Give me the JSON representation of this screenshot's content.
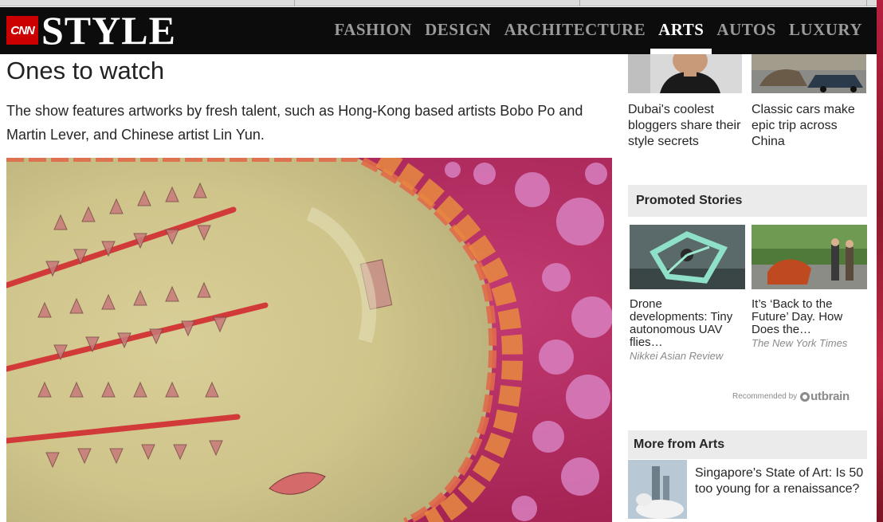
{
  "header": {
    "brand_cnn": "CNN",
    "brand_style": "STYLE",
    "nav": [
      {
        "label": "FASHION",
        "active": false
      },
      {
        "label": "DESIGN",
        "active": false
      },
      {
        "label": "ARCHITECTURE",
        "active": false
      },
      {
        "label": "ARTS",
        "active": true
      },
      {
        "label": "AUTOS",
        "active": false
      },
      {
        "label": "LUXURY",
        "active": false
      }
    ]
  },
  "article": {
    "title": "Ones to watch",
    "body": "The show features artworks by fresh talent, such as Hong-Kong based artists Bobo Po and Martin Lever, and Chinese artist Lin Yun."
  },
  "sidebar": {
    "related": [
      {
        "title": "Dubai's coolest bloggers share their style secrets"
      },
      {
        "title": "Classic cars make epic trip across China"
      }
    ],
    "promoted": {
      "heading": "Promoted Stories",
      "items": [
        {
          "title": "Drone developments: Tiny autonomous UAV flies…",
          "source": "Nikkei Asian Review"
        },
        {
          "title": "It’s ‘Back to the Future’ Day. How Does the…",
          "source": "The New York Times"
        }
      ],
      "recommended_by": "Recommended by",
      "outbrain": "utbrain"
    },
    "more": {
      "heading": "More from Arts",
      "items": [
        {
          "title": "Singapore's State of Art: Is 50 too young for a renaissance?"
        }
      ]
    }
  },
  "colors": {
    "header_bg": "#0c0c0c",
    "cnn_red": "#cc0000",
    "nav_inactive": "#9a9a9a",
    "nav_active": "#ffffff",
    "section_bg": "#ebebeb"
  }
}
